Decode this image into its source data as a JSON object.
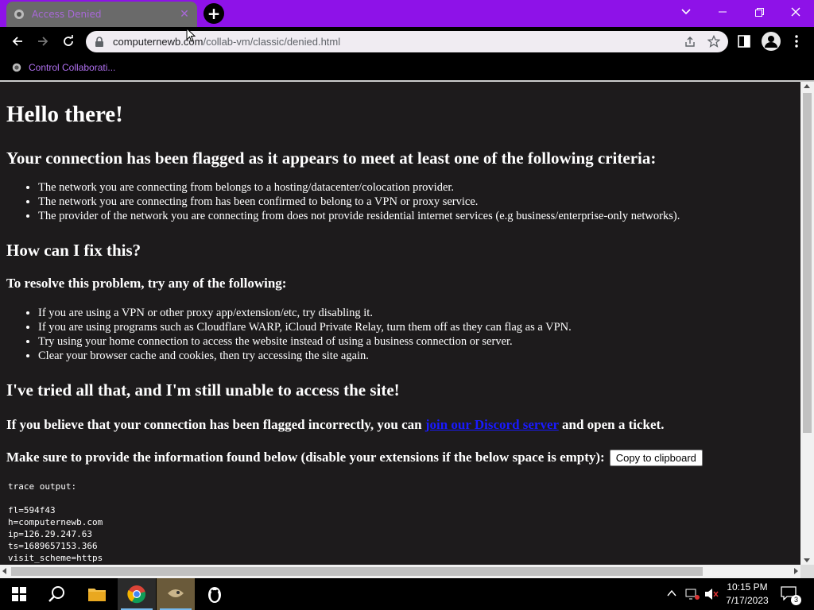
{
  "browser": {
    "tab": {
      "title": "Access Denied",
      "close_glyph": "✕"
    },
    "new_tab_glyph": "+",
    "address": {
      "host": "computernewb.com",
      "path": "/collab-vm/classic/denied.html"
    },
    "bookmark": {
      "label": "Control Collaborati..."
    },
    "colors": {
      "tabstrip": "#8e12e8",
      "page_bg": "#1d1b1c",
      "link": "#1a1aff"
    }
  },
  "page": {
    "heading": "Hello there!",
    "criteria_heading": "Your connection has been flagged as it appears to meet at least one of the following criteria:",
    "criteria": [
      "The network you are connecting from belongs to a hosting/datacenter/colocation provider.",
      "The network you are connecting from has been confirmed to belong to a VPN or proxy service.",
      "The provider of the network you are connecting from does not provide residential internet services (e.g business/enterprise-only networks)."
    ],
    "fix_heading": "How can I fix this?",
    "resolve_heading": "To resolve this problem, try any of the following:",
    "steps": [
      "If you are using a VPN or other proxy app/extension/etc, try disabling it.",
      "If you are using programs such as Cloudflare WARP, iCloud Private Relay, turn them off as they can flag as a VPN.",
      "Try using your home connection to access the website instead of using a business connection or server.",
      "Clear your browser cache and cookies, then try accessing the site again."
    ],
    "tried_heading": "I've tried all that, and I'm still unable to access the site!",
    "believe_prefix": "If you believe that your connection has been flagged incorrectly, you can ",
    "discord_link": "join our Discord server",
    "believe_suffix": " and open a ticket.",
    "provide_text": "Make sure to provide the information found below (disable your extensions if the below space is empty):",
    "copy_button": "Copy to clipboard",
    "trace_title": "trace output:",
    "trace_lines": [
      "fl=594f43",
      "h=computernewb.com",
      "ip=126.29.247.63",
      "ts=1689657153.366",
      "visit_scheme=https"
    ]
  },
  "taskbar": {
    "time": "10:15 PM",
    "date": "7/17/2023",
    "notification_count": "3"
  }
}
